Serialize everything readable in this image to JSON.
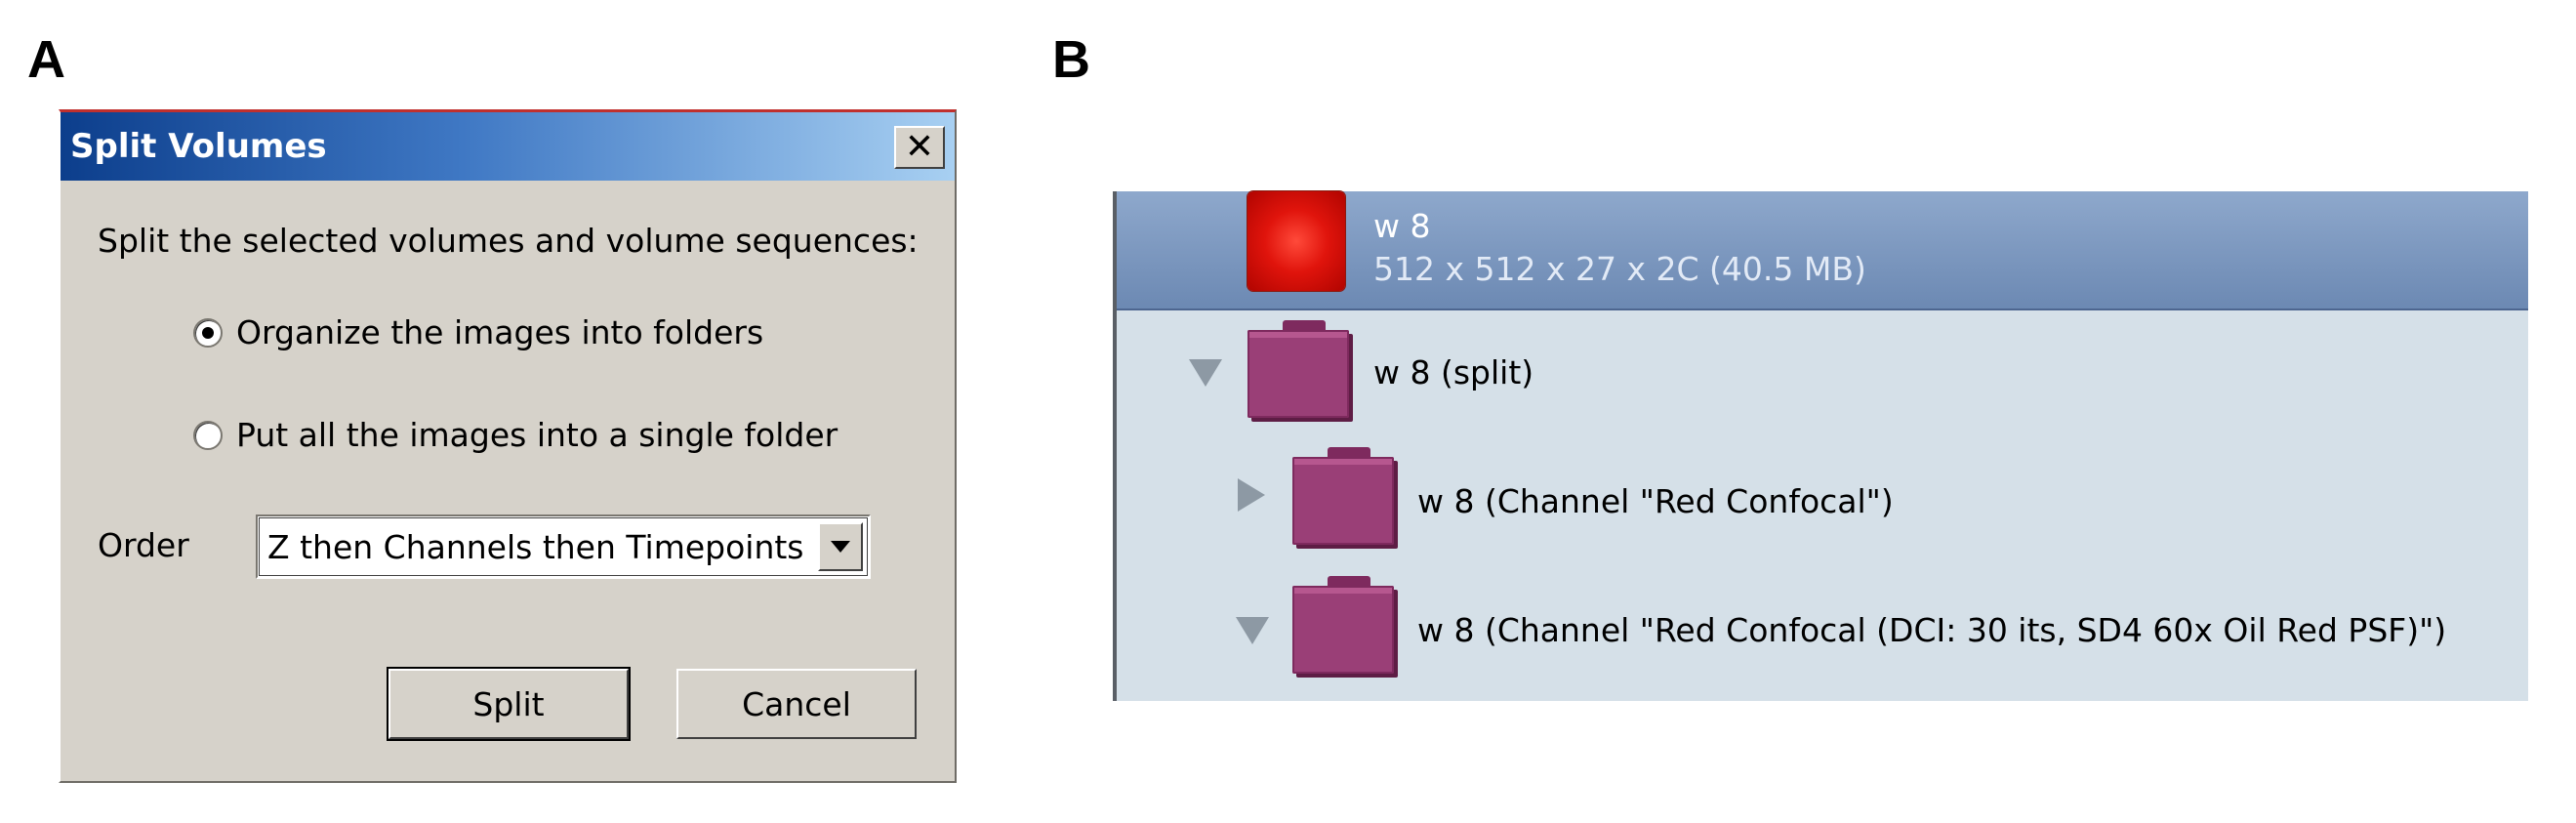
{
  "panels": {
    "a": "A",
    "b": "B"
  },
  "dialog": {
    "title": "Split Volumes",
    "close_glyph": "✕",
    "prompt": "Split the selected volumes and volume sequences:",
    "options": [
      {
        "label": "Organize the images into folders",
        "selected": true
      },
      {
        "label": "Put all the images into a single folder",
        "selected": false
      }
    ],
    "order_label": "Order",
    "order_value": "Z then Channels then Timepoints",
    "split_label": "Split",
    "cancel_label": "Cancel"
  },
  "tree": {
    "volume": {
      "name": "w 8",
      "size": "512 x 512 x 27 x 2C (40.5 MB)"
    },
    "items": [
      {
        "label": "w 8 (split)",
        "expanded": true,
        "level": 0
      },
      {
        "label": "w 8 (Channel \"Red Confocal\")",
        "expanded": false,
        "level": 1
      },
      {
        "label": "w 8 (Channel \"Red Confocal (DCI: 30 its, SD4 60x Oil Red PSF)\")",
        "expanded": true,
        "level": 1
      }
    ]
  },
  "colors": {
    "titlebar_start": "#0c3e8c",
    "titlebar_end": "#a8d0f2",
    "dialog_face": "#d6d2ca",
    "tree_background": "#d5e0e8",
    "selected_row": "#7b96be",
    "folder": "#9a3f77"
  },
  "icons": [
    "close-icon",
    "radio-selected",
    "radio-unselected",
    "dropdown-arrow-icon",
    "volume-thumbnail",
    "folder-icon",
    "expand-triangle-down-icon",
    "expand-triangle-right-icon"
  ]
}
